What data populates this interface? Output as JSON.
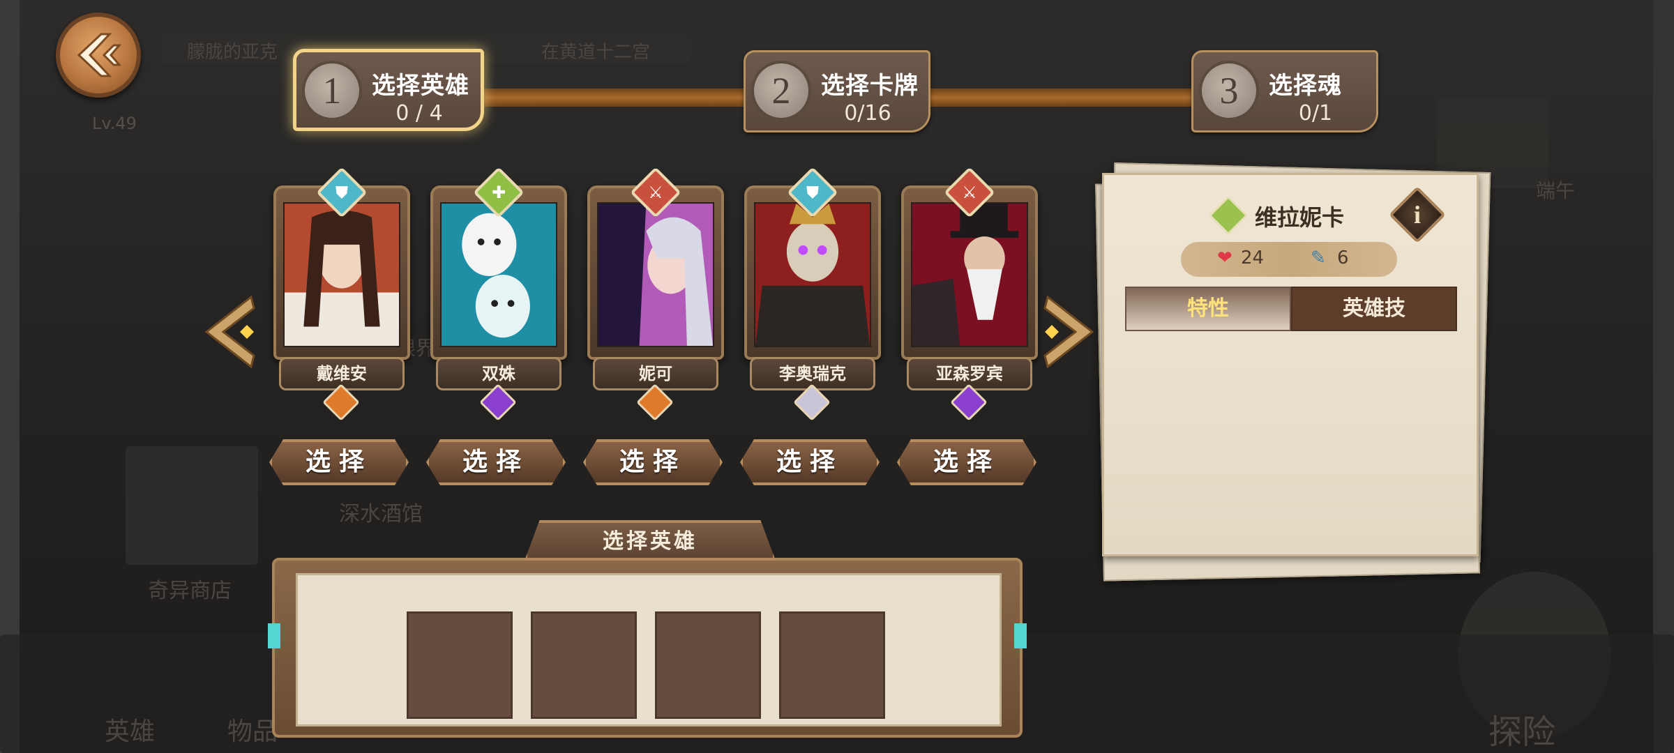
{
  "header": {
    "back_icon": "back-arrow-icon",
    "level": "Lv.49",
    "bg_labels": [
      "朦胧的亚克",
      "在黄道十二宫",
      "限界",
      "深水酒馆",
      "奇异商店",
      "端午",
      "英雄",
      "物品",
      "探险"
    ]
  },
  "steps": [
    {
      "number": "1",
      "title": "选择英雄",
      "count": "0 / 4",
      "active": true
    },
    {
      "number": "2",
      "title": "选择卡牌",
      "count": "0/16",
      "active": false
    },
    {
      "number": "3",
      "title": "选择魂",
      "count": "0/1",
      "active": false
    }
  ],
  "heroes": [
    {
      "name": "戴维安",
      "select_label": "选择",
      "class_color": "#4fb8c8",
      "class_icon": "shield-icon",
      "rarity_color": "#e07a2b"
    },
    {
      "name": "双姝",
      "select_label": "选择",
      "class_color": "#8fbf45",
      "class_icon": "heal-icon",
      "rarity_color": "#8a3fcf"
    },
    {
      "name": "妮可",
      "select_label": "选择",
      "class_color": "#c9503c",
      "class_icon": "sword-icon",
      "rarity_color": "#e07a2b"
    },
    {
      "name": "李奥瑞克",
      "select_label": "选择",
      "class_color": "#4fb8c8",
      "class_icon": "shield-icon",
      "rarity_color": "#c9c4d8"
    },
    {
      "name": "亚森罗宾",
      "select_label": "选择",
      "class_color": "#c9503c",
      "class_icon": "sword-icon",
      "rarity_color": "#8a3fcf"
    }
  ],
  "nav": {
    "prev_icon": "chevron-left-icon",
    "next_icon": "chevron-right-icon"
  },
  "detail": {
    "name": "维拉妮卡",
    "hp": "24",
    "cards": "6",
    "tabs": [
      "特性",
      "英雄技"
    ],
    "active_tab": 0,
    "info_glyph": "i"
  },
  "selection": {
    "title": "选择英雄",
    "slots": 4
  },
  "colors": {
    "gold_highlight": "#f2d38a",
    "brown": "#5c3e2a",
    "accent_yellow": "#ffe27c"
  }
}
